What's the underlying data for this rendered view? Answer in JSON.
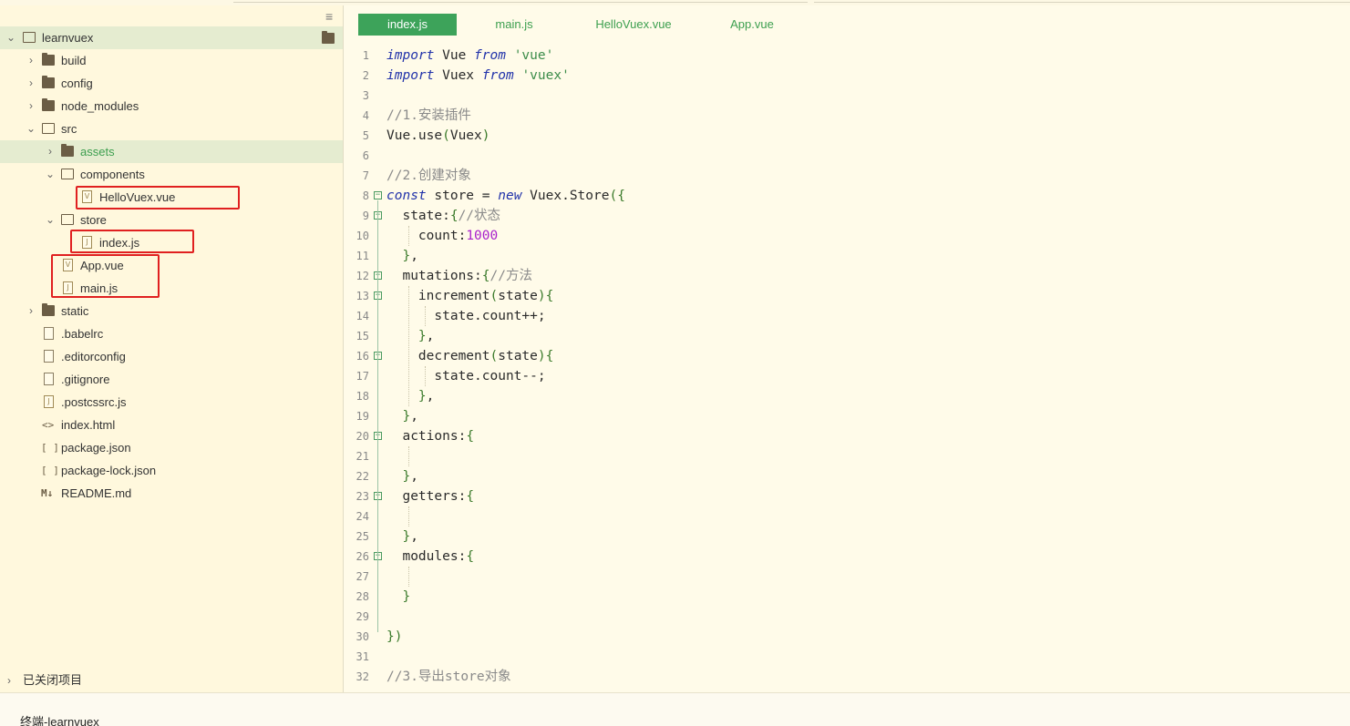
{
  "sidebar": {
    "root": "learnvuex",
    "items": [
      {
        "label": "build"
      },
      {
        "label": "config"
      },
      {
        "label": "node_modules"
      },
      {
        "label": "src"
      },
      {
        "label": "assets"
      },
      {
        "label": "components"
      },
      {
        "label": "HelloVuex.vue"
      },
      {
        "label": "store"
      },
      {
        "label": "index.js"
      },
      {
        "label": "App.vue"
      },
      {
        "label": "main.js"
      },
      {
        "label": "static"
      },
      {
        "label": ".babelrc"
      },
      {
        "label": ".editorconfig"
      },
      {
        "label": ".gitignore"
      },
      {
        "label": ".postcssrc.js"
      },
      {
        "label": "index.html"
      },
      {
        "label": "package.json"
      },
      {
        "label": "package-lock.json"
      },
      {
        "label": "README.md"
      }
    ],
    "closed_projects": "已关闭项目",
    "icons": {
      "md": "M↓",
      "html": "<>",
      "json": "[ ]",
      "vue": "V",
      "js": "J"
    }
  },
  "terminal": {
    "label": "终端-learnvuex"
  },
  "tabs": [
    {
      "label": "index.js",
      "active": true
    },
    {
      "label": "main.js",
      "active": false
    },
    {
      "label": "HelloVuex.vue",
      "active": false
    },
    {
      "label": "App.vue",
      "active": false
    }
  ],
  "editor": {
    "line_numbers": [
      "1",
      "2",
      "3",
      "4",
      "5",
      "6",
      "7",
      "8",
      "9",
      "10",
      "11",
      "12",
      "13",
      "14",
      "15",
      "16",
      "17",
      "18",
      "19",
      "20",
      "21",
      "22",
      "23",
      "24",
      "25",
      "26",
      "27",
      "28",
      "29",
      "30",
      "31",
      "32"
    ],
    "lines": [
      "import Vue from 'vue'",
      "import Vuex from 'vuex'",
      "",
      "//1.安装插件",
      "Vue.use(Vuex)",
      "",
      "//2.创建对象",
      "const store = new Vuex.Store({",
      "  state:{//状态",
      "    count:1000",
      "  },",
      "  mutations:{//方法",
      "    increment(state){",
      "      state.count++;",
      "    },",
      "    decrement(state){",
      "      state.count--;",
      "    },",
      "  },",
      "  actions:{",
      "",
      "  },",
      "  getters:{",
      "",
      "  },",
      "  modules:{",
      "",
      "  }",
      "",
      "})",
      "",
      "//3.导出store对象"
    ]
  },
  "colors": {
    "accent": "#3da35a",
    "highlight": "#e5ecd0",
    "annotation": "#e02020",
    "background": "#fffbe9"
  }
}
